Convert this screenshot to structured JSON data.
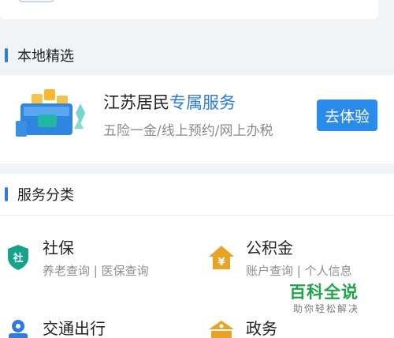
{
  "local_section": {
    "title": "本地精选"
  },
  "featured": {
    "title_plain": "江苏居民",
    "title_highlight": "专属服务",
    "subtitle": "五险一金/线上预约/网上办税",
    "button_label": "去体验"
  },
  "category_section": {
    "title": "服务分类"
  },
  "services": [
    {
      "name": "社保",
      "desc": "养老查询 | 医保查询",
      "icon": "social-insurance-shield-icon",
      "icon_text": "社",
      "color": "#17a38a"
    },
    {
      "name": "公积金",
      "desc": "账户查询 | 个人信息",
      "icon": "house-fund-icon",
      "icon_text": "¥",
      "color": "#e7a323"
    },
    {
      "name": "交通出行",
      "desc": "",
      "icon": "transport-icon",
      "icon_text": "",
      "color": "#2b7be0"
    },
    {
      "name": "政务",
      "desc": "",
      "icon": "government-building-icon",
      "icon_text": "",
      "color": "#e7a323"
    }
  ],
  "watermark": {
    "title": "百科全说",
    "subtitle": "助你轻松解决"
  },
  "colors": {
    "accent": "#2b7be0",
    "button": "#2b8be8",
    "watermark": "#22a24a"
  }
}
